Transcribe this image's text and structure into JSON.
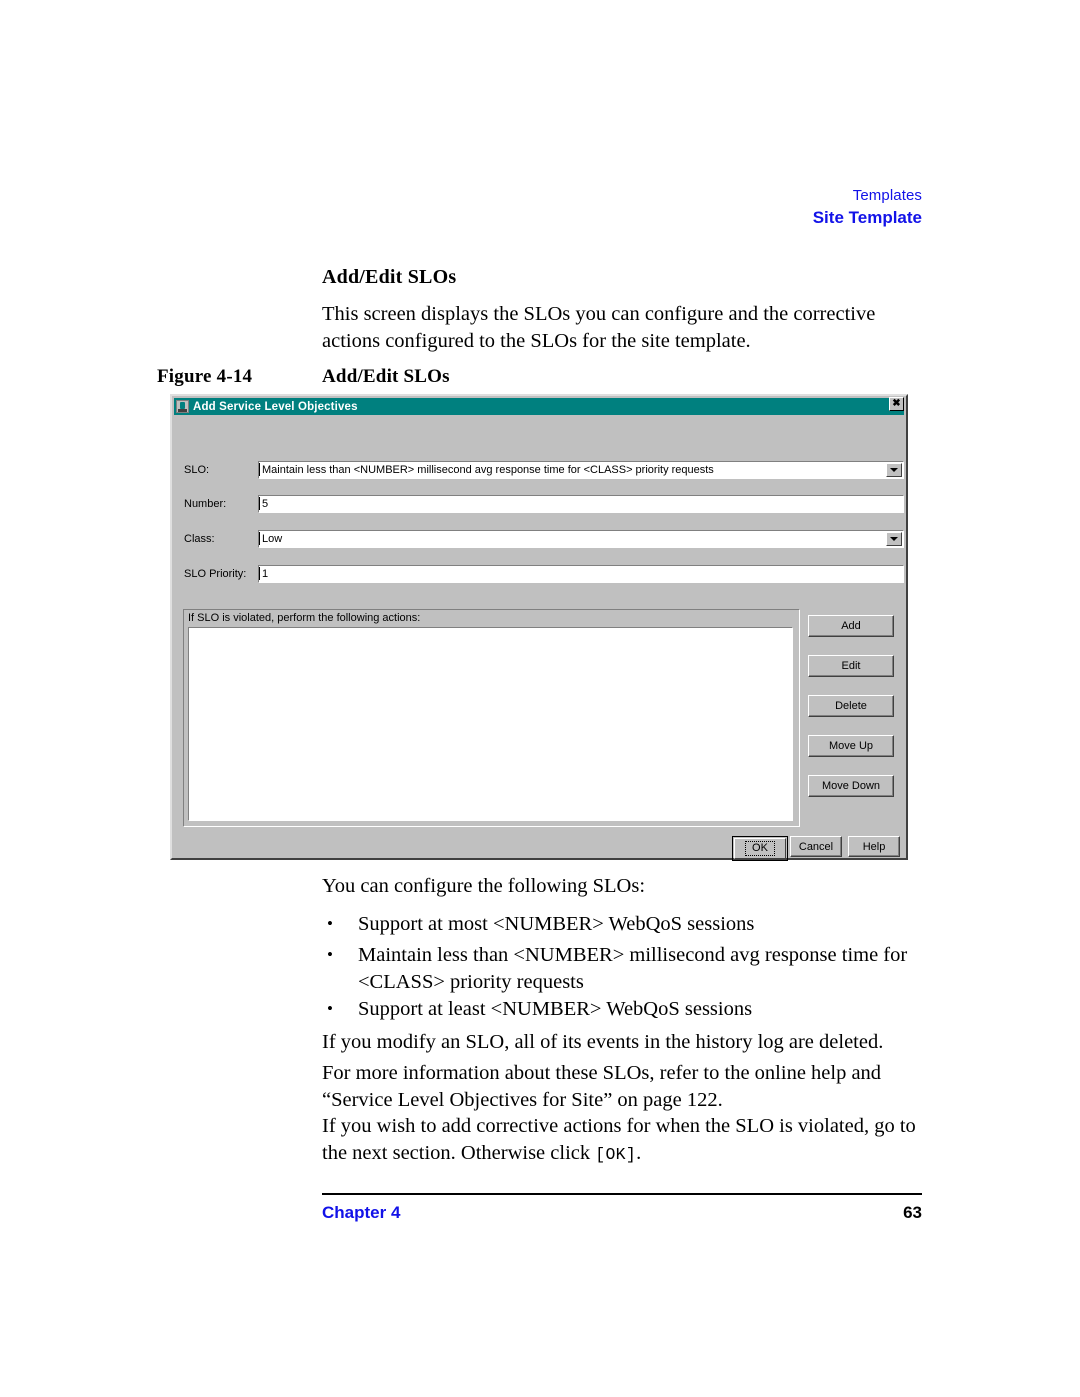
{
  "header": {
    "line1": "Templates",
    "line2": "Site Template",
    "color": "#1212e8"
  },
  "section": {
    "title": "Add/Edit SLOs",
    "intro": "This screen displays the SLOs you can configure and the corrective actions configured to the SLOs for the site template."
  },
  "figure": {
    "number": "Figure 4-14",
    "caption": "Add/Edit SLOs"
  },
  "dialog": {
    "title": "Add Service Level Objectives",
    "title_bar_color": "#00807f",
    "close_label": "✖",
    "fields": [
      {
        "label": "SLO:",
        "value": "Maintain less than <NUMBER> millisecond avg response time for <CLASS> priority requests",
        "type": "combobox"
      },
      {
        "label": "Number:",
        "value": "5",
        "type": "textbox"
      },
      {
        "label": "Class:",
        "value": "Low",
        "type": "combobox"
      },
      {
        "label": "SLO Priority:",
        "value": "1",
        "type": "textbox"
      }
    ],
    "actions_group": {
      "label": "If SLO is violated, perform the following actions:",
      "items": []
    },
    "side_buttons": [
      {
        "label": "Add"
      },
      {
        "label": "Edit"
      },
      {
        "label": "Delete"
      },
      {
        "label": "Move Up"
      },
      {
        "label": "Move Down"
      }
    ],
    "bottom_buttons": [
      {
        "label": "OK",
        "default": true
      },
      {
        "label": "Cancel",
        "default": false
      },
      {
        "label": "Help",
        "default": false
      }
    ]
  },
  "content": {
    "lead_in": "You can configure the following SLOs:",
    "bullets": [
      "Support at most <NUMBER> WebQoS sessions",
      "Maintain less than <NUMBER> millisecond avg response time for <CLASS> priority requests",
      "Support at least <NUMBER> WebQoS sessions"
    ],
    "para_modify": "If you modify an SLO, all of its events in the history log are deleted.",
    "para_more_info": "For more information about these SLOs, refer to the online help and “Service Level Objectives for Site” on page 122.",
    "para_corrective_before": "If you wish to add corrective actions for when the SLO is violated, go to the next section. Otherwise click ",
    "para_corrective_code": "[OK]",
    "para_corrective_after": "."
  },
  "footer": {
    "chapter": "Chapter 4",
    "page": "63"
  }
}
